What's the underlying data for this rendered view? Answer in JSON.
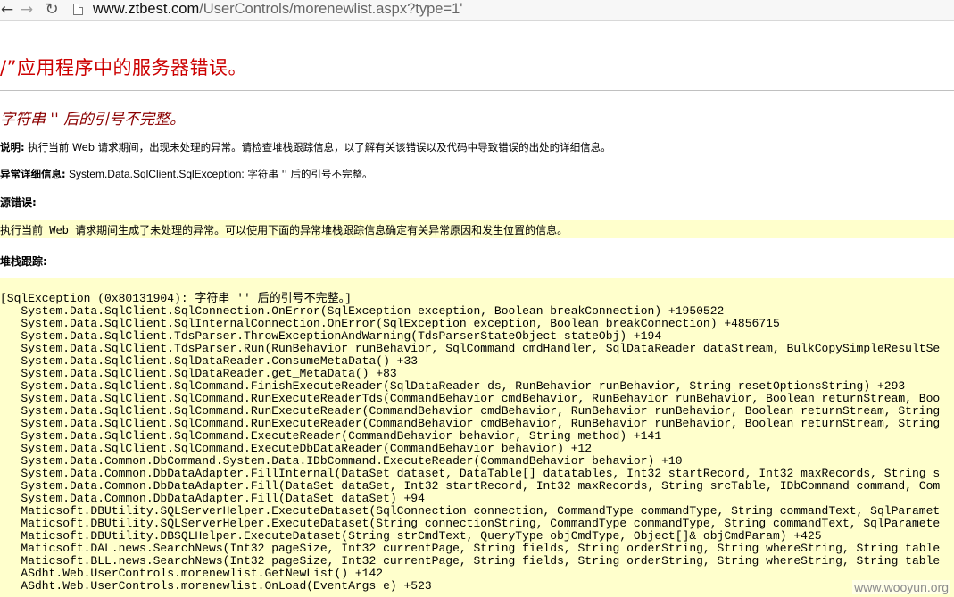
{
  "browser": {
    "url_host": "www.ztbest.com",
    "url_path": "/UserControls/morenewlist.aspx?type=1'",
    "back_icon": "arrow-left-icon",
    "forward_icon": "arrow-right-icon",
    "reload_icon": "reload-icon"
  },
  "page": {
    "title": "/”应用程序中的服务器错误。",
    "error_message": "字符串 '' 后的引号不完整。",
    "description_label": "说明:",
    "description_text": " 执行当前 Web 请求期间，出现未处理的异常。请检查堆栈跟踪信息，以了解有关该错误以及代码中导致错误的出处的详细信息。",
    "exception_label": "异常详细信息:",
    "exception_value": " System.Data.SqlClient.SqlException:",
    "exception_text": " 字符串 '' 后的引号不完整。",
    "source_error_label": "源错误:",
    "source_error_text": "执行当前 Web 请求期间生成了未处理的异常。可以使用下面的异常堆栈跟踪信息确定有关异常原因和发生位置的信息。",
    "stack_trace_label": "堆栈跟踪:"
  },
  "stack_trace": [
    "[SqlException (0x80131904): 字符串 '' 后的引号不完整。]",
    "   System.Data.SqlClient.SqlConnection.OnError(SqlException exception, Boolean breakConnection) +1950522",
    "   System.Data.SqlClient.SqlInternalConnection.OnError(SqlException exception, Boolean breakConnection) +4856715",
    "   System.Data.SqlClient.TdsParser.ThrowExceptionAndWarning(TdsParserStateObject stateObj) +194",
    "   System.Data.SqlClient.TdsParser.Run(RunBehavior runBehavior, SqlCommand cmdHandler, SqlDataReader dataStream, BulkCopySimpleResultSe",
    "   System.Data.SqlClient.SqlDataReader.ConsumeMetaData() +33",
    "   System.Data.SqlClient.SqlDataReader.get_MetaData() +83",
    "   System.Data.SqlClient.SqlCommand.FinishExecuteReader(SqlDataReader ds, RunBehavior runBehavior, String resetOptionsString) +293",
    "   System.Data.SqlClient.SqlCommand.RunExecuteReaderTds(CommandBehavior cmdBehavior, RunBehavior runBehavior, Boolean returnStream, Boo",
    "   System.Data.SqlClient.SqlCommand.RunExecuteReader(CommandBehavior cmdBehavior, RunBehavior runBehavior, Boolean returnStream, String",
    "   System.Data.SqlClient.SqlCommand.RunExecuteReader(CommandBehavior cmdBehavior, RunBehavior runBehavior, Boolean returnStream, String",
    "   System.Data.SqlClient.SqlCommand.ExecuteReader(CommandBehavior behavior, String method) +141",
    "   System.Data.SqlClient.SqlCommand.ExecuteDbDataReader(CommandBehavior behavior) +12",
    "   System.Data.Common.DbCommand.System.Data.IDbCommand.ExecuteReader(CommandBehavior behavior) +10",
    "   System.Data.Common.DbDataAdapter.FillInternal(DataSet dataset, DataTable[] datatables, Int32 startRecord, Int32 maxRecords, String s",
    "   System.Data.Common.DbDataAdapter.Fill(DataSet dataSet, Int32 startRecord, Int32 maxRecords, String srcTable, IDbCommand command, Com",
    "   System.Data.Common.DbDataAdapter.Fill(DataSet dataSet) +94",
    "   Maticsoft.DBUtility.SQLServerHelper.ExecuteDataset(SqlConnection connection, CommandType commandType, String commandText, SqlParamet",
    "   Maticsoft.DBUtility.SQLServerHelper.ExecuteDataset(String connectionString, CommandType commandType, String commandText, SqlParamete",
    "   Maticsoft.DBUtility.DBSQLHelper.ExecuteDataset(String strCmdText, QueryType objCmdType, Object[]& objCmdParam) +425",
    "   Maticsoft.DAL.news.SearchNews(Int32 pageSize, Int32 currentPage, String fields, String orderString, String whereString, String table",
    "   Maticsoft.BLL.news.SearchNews(Int32 pageSize, Int32 currentPage, String fields, String orderString, String whereString, String table",
    "   ASdht.Web.UserControls.morenewlist.GetNewList() +142",
    "   ASdht.Web.UserControls.morenewlist.OnLoad(EventArgs e) +523"
  ],
  "watermark": "www.wooyun.org"
}
